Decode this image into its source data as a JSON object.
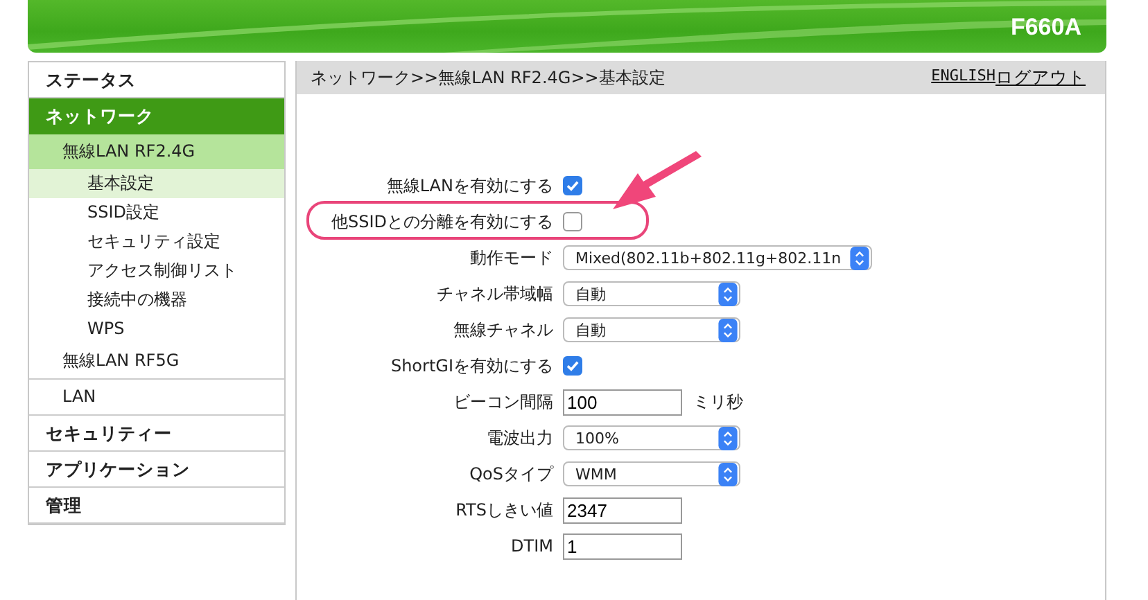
{
  "header": {
    "model": "F660A"
  },
  "sidebar": {
    "items": [
      {
        "label": "ステータス",
        "selected": false
      },
      {
        "label": "ネットワーク",
        "selected": true,
        "expanded": true,
        "children": [
          {
            "label": "無線LAN RF2.4G",
            "selected": true,
            "expanded": true,
            "children": [
              {
                "label": "基本設定",
                "selected": true
              },
              {
                "label": "SSID設定",
                "selected": false
              },
              {
                "label": "セキュリティ設定",
                "selected": false
              },
              {
                "label": "アクセス制御リスト",
                "selected": false
              },
              {
                "label": "接続中の機器",
                "selected": false
              },
              {
                "label": "WPS",
                "selected": false
              }
            ]
          },
          {
            "label": "無線LAN RF5G",
            "selected": false
          },
          {
            "label": "LAN",
            "selected": false
          }
        ]
      },
      {
        "label": "セキュリティー",
        "selected": false
      },
      {
        "label": "アプリケーション",
        "selected": false
      },
      {
        "label": "管理",
        "selected": false
      }
    ]
  },
  "breadcrumb": "ネットワーク>>無線LAN RF2.4G>>基本設定",
  "top_links": [
    "ENGLISH",
    "ログアウト"
  ],
  "form": {
    "rows": [
      {
        "kind": "checkbox",
        "label": "無線LANを有効にする",
        "checked": true,
        "highlighted": false
      },
      {
        "kind": "checkbox",
        "label": "他SSIDとの分離を有効にする",
        "checked": false,
        "highlighted": true
      },
      {
        "kind": "select",
        "label": "動作モード",
        "value": "Mixed(802.11b+802.11g+802.11n",
        "highlighted": false
      },
      {
        "kind": "select",
        "label": "チャネル帯域幅",
        "value": "自動",
        "highlighted": false
      },
      {
        "kind": "select",
        "label": "無線チャネル",
        "value": "自動",
        "highlighted": false
      },
      {
        "kind": "checkbox",
        "label": "ShortGIを有効にする",
        "checked": true,
        "highlighted": false
      },
      {
        "kind": "text",
        "label": "ビーコン間隔",
        "value": "100",
        "unit": "ミリ秒",
        "highlighted": false
      },
      {
        "kind": "select",
        "label": "電波出力",
        "value": "100%",
        "highlighted": false
      },
      {
        "kind": "select",
        "label": "QoSタイプ",
        "value": "WMM",
        "highlighted": false
      },
      {
        "kind": "text",
        "label": "RTSしきい値",
        "value": "2347",
        "highlighted": false
      },
      {
        "kind": "text",
        "label": "DTIM",
        "value": "1",
        "highlighted": false
      }
    ]
  }
}
